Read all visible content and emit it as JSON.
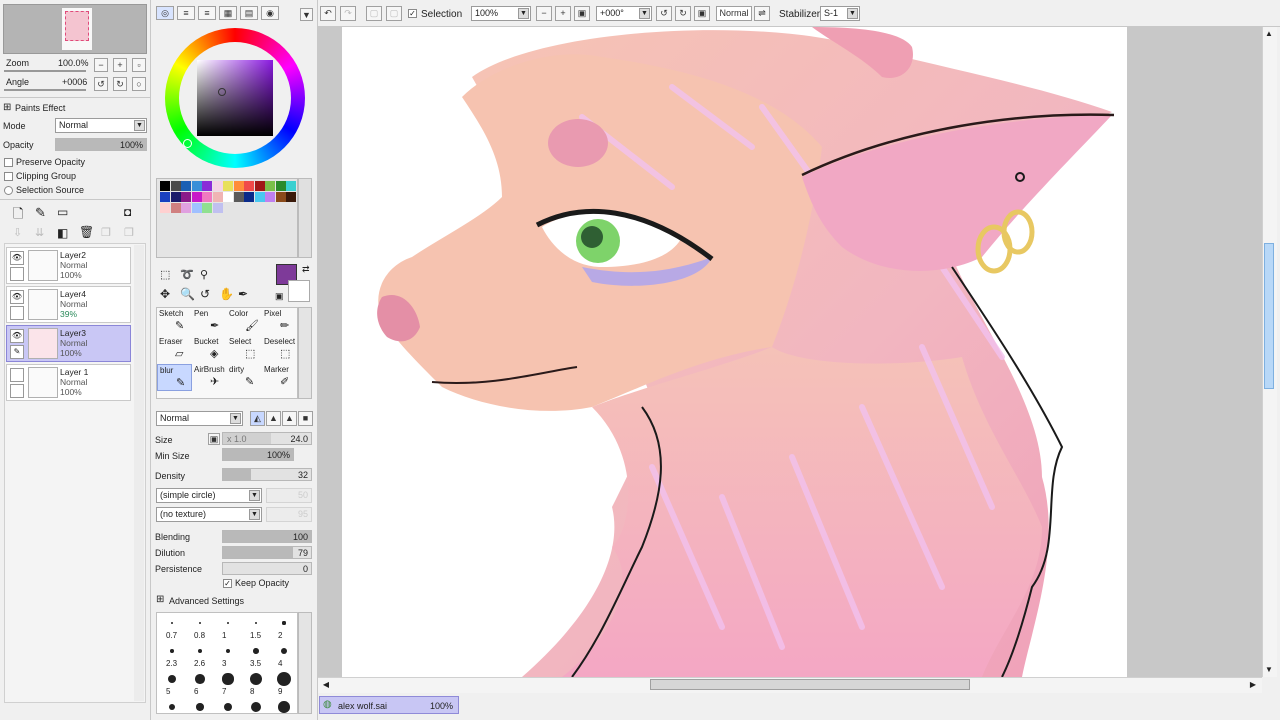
{
  "navigator": {
    "zoom_label": "Zoom",
    "zoom_value": "100.0%",
    "angle_label": "Angle",
    "angle_value": "+0006"
  },
  "paint_effect": {
    "title": "Paints Effect",
    "mode_label": "Mode",
    "mode_value": "Normal",
    "opacity_label": "Opacity",
    "opacity_value": "100%",
    "opacity_level": 1.0,
    "preserve_opacity": "Preserve Opacity",
    "clipping_group": "Clipping Group",
    "selection_source": "Selection Source"
  },
  "layers": [
    {
      "name": "Layer2",
      "mode": "Normal",
      "opacity": "100%",
      "visible": true,
      "active": false
    },
    {
      "name": "Layer4",
      "mode": "Normal",
      "opacity": "39%",
      "visible": true,
      "active": false
    },
    {
      "name": "Layer3",
      "mode": "Normal",
      "opacity": "100%",
      "visible": true,
      "active": true
    },
    {
      "name": "Layer 1",
      "mode": "Normal",
      "opacity": "100%",
      "visible": false,
      "active": false
    }
  ],
  "current_color": "#7e3a99",
  "palette": [
    "#000000",
    "#4a4a4a",
    "#1a5fb4",
    "#3a8fd8",
    "#8a2bd8",
    "#f4d4e4",
    "#e8e05a",
    "#ff8c3a",
    "#f04a4a",
    "#a01818",
    "#7ac04a",
    "#2a8a2a",
    "#3ad0d0",
    "#1a40c0",
    "#1a1a6a",
    "#8a1a8a",
    "#c81ac8",
    "#f07ac0",
    "#f0b4b4",
    "#ffffff",
    "#5a5a5a",
    "#0a2a8a",
    "#4ac8f0",
    "#c080f0",
    "#8a4a1a",
    "#3a1a0a",
    "#ffd0d0",
    "#d08080",
    "#e0a0e0",
    "#a0c0ff",
    "#90e090",
    "#c0c0f0"
  ],
  "tools": [
    {
      "name": "Sketch",
      "icon": "pencil-icon"
    },
    {
      "name": "Pen",
      "icon": "pen-icon"
    },
    {
      "name": "Color",
      "icon": "brush-icon"
    },
    {
      "name": "Pixel",
      "icon": "pixel-pen-icon"
    },
    {
      "name": "Eraser",
      "icon": "eraser-icon"
    },
    {
      "name": "Bucket",
      "icon": "bucket-icon"
    },
    {
      "name": "Select",
      "icon": "select-brush-icon"
    },
    {
      "name": "Deselect",
      "icon": "deselect-brush-icon"
    },
    {
      "name": "blur",
      "icon": "blur-icon"
    },
    {
      "name": "AirBrush",
      "icon": "airbrush-icon"
    },
    {
      "name": "dirty",
      "icon": "dirty-brush-icon"
    },
    {
      "name": "Marker",
      "icon": "marker-icon"
    }
  ],
  "brush": {
    "blend_mode": "Normal",
    "size_label": "Size",
    "size_mult": "x 1.0",
    "size_value": "24.0",
    "min_size_label": "Min Size",
    "min_size_value": "100%",
    "min_size_level": 1.0,
    "density_label": "Density",
    "density_value": "32",
    "density_level": 0.32,
    "shape": "(simple circle)",
    "shape_value": "50",
    "texture": "(no texture)",
    "texture_value": "95",
    "blending_label": "Blending",
    "blending_value": "100",
    "blending_level": 1.0,
    "dilution_label": "Dilution",
    "dilution_value": "79",
    "dilution_level": 0.79,
    "persistence_label": "Persistence",
    "persistence_value": "0",
    "persistence_level": 0,
    "keep_opacity": "Keep Opacity",
    "advanced": "Advanced Settings"
  },
  "brush_sizes": [
    "0.7",
    "0.8",
    "1",
    "1.5",
    "2",
    "2.3",
    "2.6",
    "3",
    "3.5",
    "4",
    "5",
    "6",
    "7",
    "8",
    "9"
  ],
  "toolbar": {
    "selection_label": "Selection",
    "zoom": "100%",
    "angle": "+000°",
    "blend": "Normal",
    "stabilizer_label": "Stabilizer",
    "stabilizer_value": "S-1"
  },
  "document_tab": {
    "name": "alex wolf.sai",
    "zoom": "100%"
  }
}
